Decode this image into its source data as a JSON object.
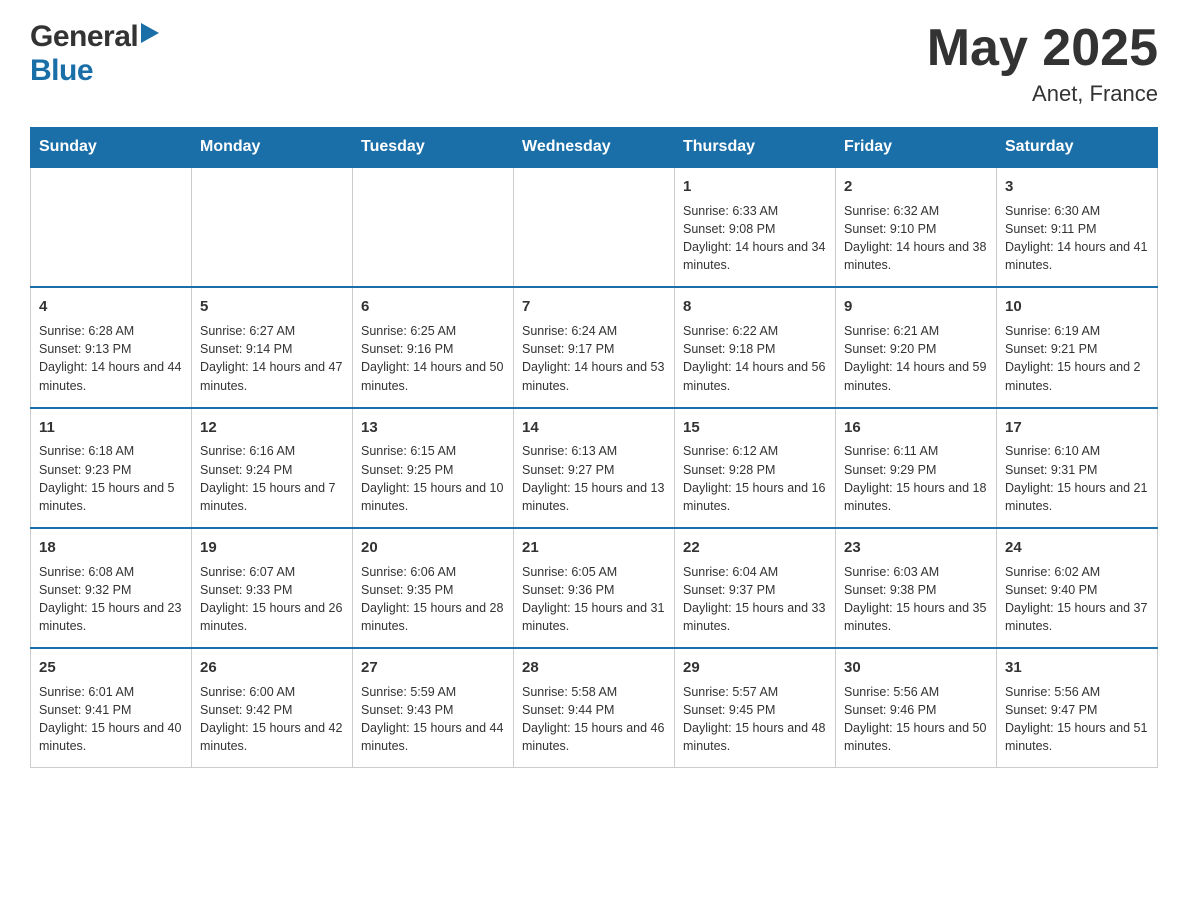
{
  "header": {
    "title": "May 2025",
    "location": "Anet, France"
  },
  "logo": {
    "general": "General",
    "blue": "Blue"
  },
  "days_of_week": [
    "Sunday",
    "Monday",
    "Tuesday",
    "Wednesday",
    "Thursday",
    "Friday",
    "Saturday"
  ],
  "weeks": [
    [
      {
        "day": "",
        "info": ""
      },
      {
        "day": "",
        "info": ""
      },
      {
        "day": "",
        "info": ""
      },
      {
        "day": "",
        "info": ""
      },
      {
        "day": "1",
        "info": "Sunrise: 6:33 AM\nSunset: 9:08 PM\nDaylight: 14 hours and 34 minutes."
      },
      {
        "day": "2",
        "info": "Sunrise: 6:32 AM\nSunset: 9:10 PM\nDaylight: 14 hours and 38 minutes."
      },
      {
        "day": "3",
        "info": "Sunrise: 6:30 AM\nSunset: 9:11 PM\nDaylight: 14 hours and 41 minutes."
      }
    ],
    [
      {
        "day": "4",
        "info": "Sunrise: 6:28 AM\nSunset: 9:13 PM\nDaylight: 14 hours and 44 minutes."
      },
      {
        "day": "5",
        "info": "Sunrise: 6:27 AM\nSunset: 9:14 PM\nDaylight: 14 hours and 47 minutes."
      },
      {
        "day": "6",
        "info": "Sunrise: 6:25 AM\nSunset: 9:16 PM\nDaylight: 14 hours and 50 minutes."
      },
      {
        "day": "7",
        "info": "Sunrise: 6:24 AM\nSunset: 9:17 PM\nDaylight: 14 hours and 53 minutes."
      },
      {
        "day": "8",
        "info": "Sunrise: 6:22 AM\nSunset: 9:18 PM\nDaylight: 14 hours and 56 minutes."
      },
      {
        "day": "9",
        "info": "Sunrise: 6:21 AM\nSunset: 9:20 PM\nDaylight: 14 hours and 59 minutes."
      },
      {
        "day": "10",
        "info": "Sunrise: 6:19 AM\nSunset: 9:21 PM\nDaylight: 15 hours and 2 minutes."
      }
    ],
    [
      {
        "day": "11",
        "info": "Sunrise: 6:18 AM\nSunset: 9:23 PM\nDaylight: 15 hours and 5 minutes."
      },
      {
        "day": "12",
        "info": "Sunrise: 6:16 AM\nSunset: 9:24 PM\nDaylight: 15 hours and 7 minutes."
      },
      {
        "day": "13",
        "info": "Sunrise: 6:15 AM\nSunset: 9:25 PM\nDaylight: 15 hours and 10 minutes."
      },
      {
        "day": "14",
        "info": "Sunrise: 6:13 AM\nSunset: 9:27 PM\nDaylight: 15 hours and 13 minutes."
      },
      {
        "day": "15",
        "info": "Sunrise: 6:12 AM\nSunset: 9:28 PM\nDaylight: 15 hours and 16 minutes."
      },
      {
        "day": "16",
        "info": "Sunrise: 6:11 AM\nSunset: 9:29 PM\nDaylight: 15 hours and 18 minutes."
      },
      {
        "day": "17",
        "info": "Sunrise: 6:10 AM\nSunset: 9:31 PM\nDaylight: 15 hours and 21 minutes."
      }
    ],
    [
      {
        "day": "18",
        "info": "Sunrise: 6:08 AM\nSunset: 9:32 PM\nDaylight: 15 hours and 23 minutes."
      },
      {
        "day": "19",
        "info": "Sunrise: 6:07 AM\nSunset: 9:33 PM\nDaylight: 15 hours and 26 minutes."
      },
      {
        "day": "20",
        "info": "Sunrise: 6:06 AM\nSunset: 9:35 PM\nDaylight: 15 hours and 28 minutes."
      },
      {
        "day": "21",
        "info": "Sunrise: 6:05 AM\nSunset: 9:36 PM\nDaylight: 15 hours and 31 minutes."
      },
      {
        "day": "22",
        "info": "Sunrise: 6:04 AM\nSunset: 9:37 PM\nDaylight: 15 hours and 33 minutes."
      },
      {
        "day": "23",
        "info": "Sunrise: 6:03 AM\nSunset: 9:38 PM\nDaylight: 15 hours and 35 minutes."
      },
      {
        "day": "24",
        "info": "Sunrise: 6:02 AM\nSunset: 9:40 PM\nDaylight: 15 hours and 37 minutes."
      }
    ],
    [
      {
        "day": "25",
        "info": "Sunrise: 6:01 AM\nSunset: 9:41 PM\nDaylight: 15 hours and 40 minutes."
      },
      {
        "day": "26",
        "info": "Sunrise: 6:00 AM\nSunset: 9:42 PM\nDaylight: 15 hours and 42 minutes."
      },
      {
        "day": "27",
        "info": "Sunrise: 5:59 AM\nSunset: 9:43 PM\nDaylight: 15 hours and 44 minutes."
      },
      {
        "day": "28",
        "info": "Sunrise: 5:58 AM\nSunset: 9:44 PM\nDaylight: 15 hours and 46 minutes."
      },
      {
        "day": "29",
        "info": "Sunrise: 5:57 AM\nSunset: 9:45 PM\nDaylight: 15 hours and 48 minutes."
      },
      {
        "day": "30",
        "info": "Sunrise: 5:56 AM\nSunset: 9:46 PM\nDaylight: 15 hours and 50 minutes."
      },
      {
        "day": "31",
        "info": "Sunrise: 5:56 AM\nSunset: 9:47 PM\nDaylight: 15 hours and 51 minutes."
      }
    ]
  ]
}
